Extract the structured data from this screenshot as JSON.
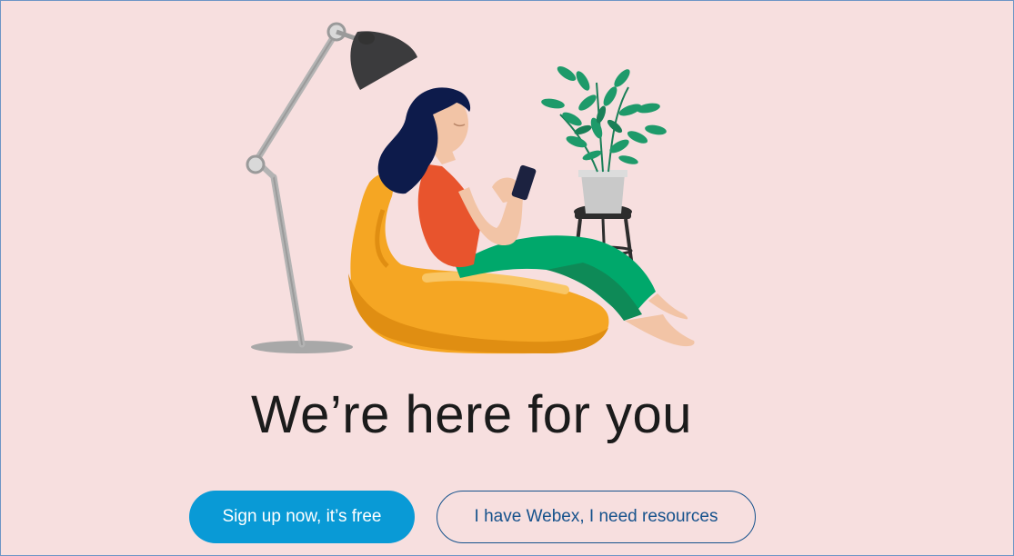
{
  "hero": {
    "headline": "We’re here for you",
    "illustration_icon": "woman-on-beanbag-with-phone-illustration"
  },
  "actions": {
    "signup_label": "Sign up now, it’s free",
    "resources_label": "I have Webex, I need resources"
  },
  "colors": {
    "background": "#f7dfdf",
    "primary_button": "#099ad6",
    "secondary_border": "#16528c",
    "frame_border": "#6d95c6"
  }
}
